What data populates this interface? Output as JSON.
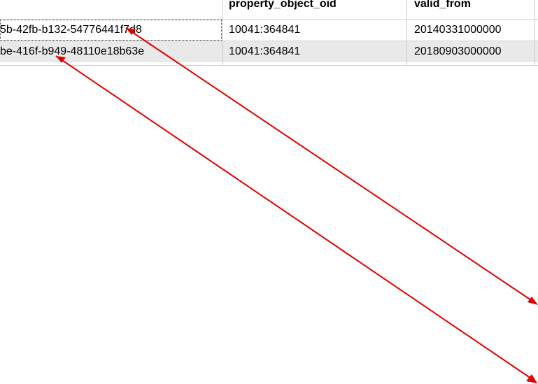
{
  "grid": {
    "headers": [
      "property_object_oid",
      "valid_from"
    ],
    "rows": [
      {
        "oid": "5b-42fb-b132-54776441f7d8",
        "property_object_oid": "10041:364841",
        "valid_from": "20140331000000"
      },
      {
        "oid": "be-416f-b949-48110e18b63e",
        "property_object_oid": "10041:364841",
        "valid_from": "20180903000000"
      }
    ]
  },
  "colors": {
    "annotation_arrow": "#e00000",
    "selected_row_bg": "#e9e9e9"
  }
}
